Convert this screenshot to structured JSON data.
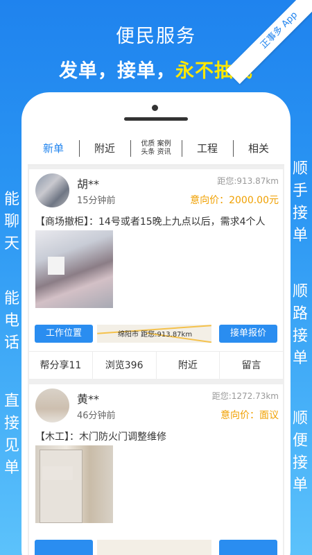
{
  "banner": {
    "title": "便民服务",
    "subtitle_part1": "发单，接单，",
    "subtitle_highlight": "永不抽成",
    "ribbon": "正事多 App",
    "left_text_1": "能聊天",
    "left_text_2": "能电话",
    "left_text_3": "直接见单",
    "right_text_1": "顺手接单",
    "right_text_2": "顺路接单",
    "right_text_3": "顺便接单"
  },
  "tabs": [
    {
      "label": "新单",
      "active": true
    },
    {
      "label": "附近"
    },
    {
      "label_line1": "优质 案例",
      "label_line2": "头条 资讯"
    },
    {
      "label": "工程"
    },
    {
      "label": "相关"
    }
  ],
  "orders": [
    {
      "user": "胡**",
      "time": "15分钟前",
      "distance": "距您:913.87km",
      "price_label": "意向价：",
      "price_value": "2000.00元",
      "description": "【商场撤柜】：14号或者15晚上九点以后，需求4个人",
      "location_button": "工作位置",
      "map_label": "绵阳市 距您:913.87km",
      "bid_button": "接单报价",
      "share": "帮分享11",
      "views": "浏览396",
      "nearby": "附近",
      "message": "留言"
    },
    {
      "user": "黄**",
      "time": "46分钟前",
      "distance": "距您:1272.73km",
      "price_label": "意向价：",
      "price_value": "面议",
      "description": "【木工】：木门防火门调整维修"
    }
  ],
  "colors": {
    "accent": "#1f83ee",
    "price": "#f0a000",
    "highlight": "#ffe800"
  }
}
